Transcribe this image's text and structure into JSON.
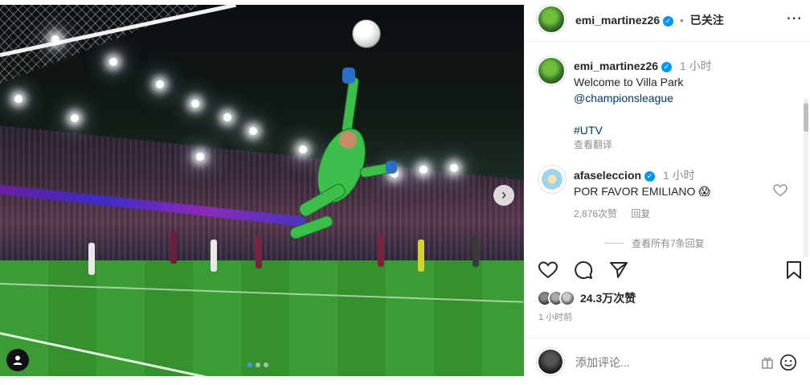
{
  "post": {
    "image_alt_icons": {
      "tag": "person-icon",
      "next": "chevron-right-icon"
    },
    "carousel": {
      "count": 3,
      "active_index": 0
    }
  },
  "header": {
    "username": "emi_martinez26",
    "separator": "•",
    "follow_status": "已关注",
    "more_label": "⋯"
  },
  "caption": {
    "username": "emi_martinez26",
    "time": "1 小时",
    "line1": "Welcome to Villa Park",
    "mention": "@championsleague",
    "hashtag": "#UTV",
    "translate": "查看翻译"
  },
  "comment": {
    "username": "afaseleccion",
    "time": "1 小时",
    "text": "POR FAVOR EMILIANO",
    "emoji": "😱",
    "likes": "2,876次赞",
    "reply": "回复",
    "view_replies": "查看所有7条回复"
  },
  "stats": {
    "likes": "24.3万次赞",
    "time_ago": "1 小时前"
  },
  "compose": {
    "placeholder": "添加评论..."
  },
  "colors": {
    "verified": "#0095f6",
    "carousel_active": "#3897f0",
    "keeper_kit": "#3cbf4a"
  }
}
